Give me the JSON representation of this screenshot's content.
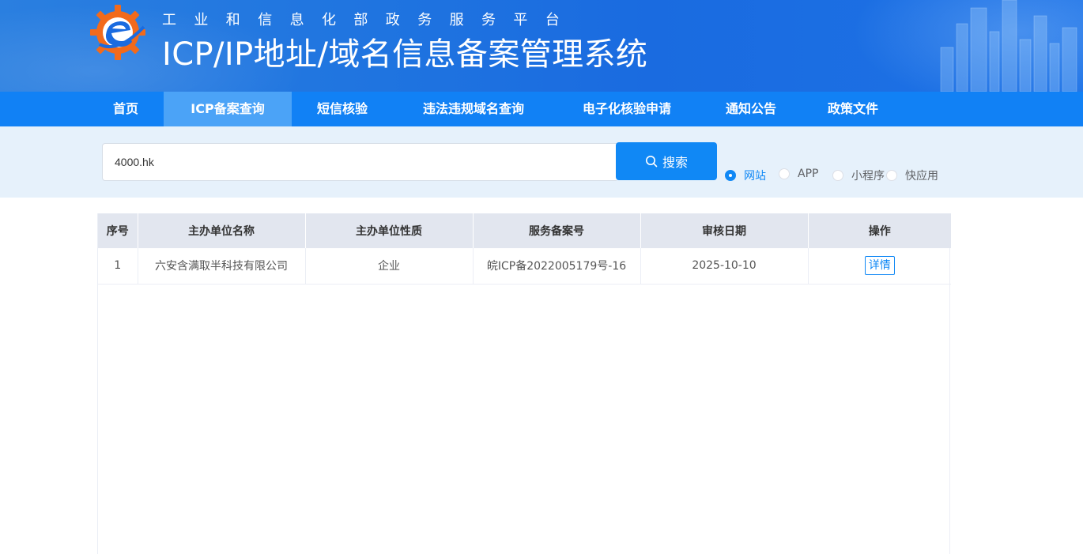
{
  "header": {
    "subtitle": "工业和信息化部政务服务平台",
    "title": "ICP/IP地址/域名信息备案管理系统",
    "colors": {
      "banner": "#1f74e0",
      "logo_orange": "#f26a1b",
      "logo_blue": "#1a6be0"
    }
  },
  "nav": {
    "items": [
      {
        "label": "首页"
      },
      {
        "label": "ICP备案查询",
        "active": true
      },
      {
        "label": "短信核验"
      },
      {
        "label": "违法违规域名查询"
      },
      {
        "label": "电子化核验申请"
      },
      {
        "label": "通知公告"
      },
      {
        "label": "政策文件"
      }
    ],
    "colors": {
      "bar": "#1181f5",
      "active": "#4ba3f7"
    }
  },
  "search": {
    "value": "4000.hk",
    "button_label": "搜索",
    "button_icon": "search-icon",
    "types": [
      {
        "label": "网站",
        "checked": true
      },
      {
        "label": "APP",
        "checked": false
      },
      {
        "label": "小程序",
        "checked": false
      },
      {
        "label": "快应用",
        "checked": false
      }
    ]
  },
  "results": {
    "columns": [
      "序号",
      "主办单位名称",
      "主办单位性质",
      "服务备案号",
      "审核日期",
      "操作"
    ],
    "rows": [
      {
        "index": "1",
        "org_name": "六安含满取半科技有限公司",
        "org_type": "企业",
        "record_no": "皖ICP备2022005179号-16",
        "audit_date": "2025-10-10",
        "action": "详情"
      }
    ]
  }
}
